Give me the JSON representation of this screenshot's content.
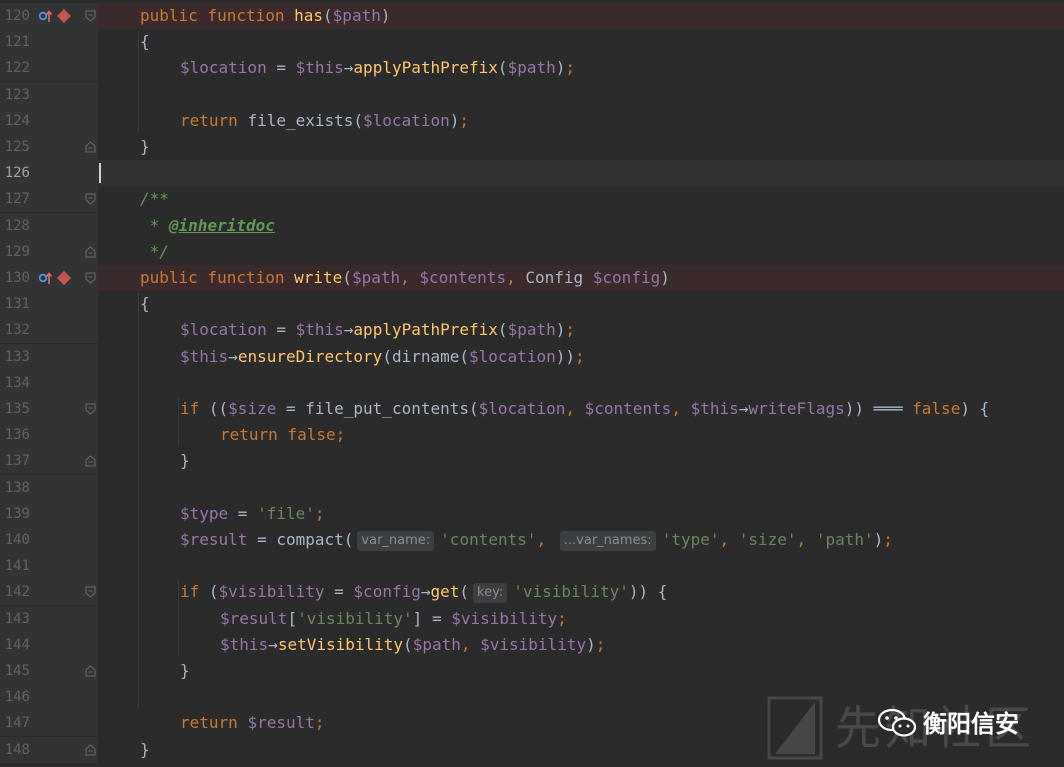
{
  "colors": {
    "background": "#2b2b2b",
    "gutter": "#313335",
    "breakpoint_line": "#3b2a2b",
    "keyword": "#cc7832",
    "function": "#ffc66d",
    "variable": "#9876aa",
    "string": "#6a8759",
    "plain": "#a9b7c6",
    "doc_comment": "#629755",
    "line_number": "#606366"
  },
  "lines": [
    {
      "num": "120",
      "indent": 0,
      "highlight": true,
      "override": true,
      "breakpoint": true,
      "fold": "start",
      "tokens": [
        {
          "c": "kw",
          "t": "public function "
        },
        {
          "c": "fn",
          "t": "has"
        },
        {
          "c": "pl",
          "t": "("
        },
        {
          "c": "vr",
          "t": "$path"
        },
        {
          "c": "pl",
          "t": ")"
        }
      ]
    },
    {
      "num": "121",
      "indent": 0,
      "tokens": [
        {
          "c": "pl",
          "t": "{"
        }
      ]
    },
    {
      "num": "122",
      "indent": 1,
      "tokens": [
        {
          "c": "vr",
          "t": "$location"
        },
        {
          "c": "pl",
          "t": " = "
        },
        {
          "c": "vr",
          "t": "$this"
        },
        {
          "c": "pl",
          "t": "→"
        },
        {
          "c": "fn",
          "t": "applyPathPrefix"
        },
        {
          "c": "pl",
          "t": "("
        },
        {
          "c": "vr",
          "t": "$path"
        },
        {
          "c": "pl",
          "t": ")"
        },
        {
          "c": "kw",
          "t": ";"
        }
      ]
    },
    {
      "num": "123",
      "indent": 1,
      "tokens": []
    },
    {
      "num": "124",
      "indent": 1,
      "tokens": [
        {
          "c": "kw",
          "t": "return "
        },
        {
          "c": "pl",
          "t": "file_exists("
        },
        {
          "c": "vr",
          "t": "$location"
        },
        {
          "c": "pl",
          "t": ")"
        },
        {
          "c": "kw",
          "t": ";"
        }
      ]
    },
    {
      "num": "125",
      "indent": 0,
      "fold": "end",
      "tokens": [
        {
          "c": "pl",
          "t": "}"
        }
      ]
    },
    {
      "num": "126",
      "indent": 0,
      "current": true,
      "tokens": []
    },
    {
      "num": "127",
      "indent": 0,
      "fold": "start",
      "tokens": [
        {
          "c": "cm",
          "t": "/**"
        }
      ]
    },
    {
      "num": "128",
      "indent": 0,
      "tokens": [
        {
          "c": "cm",
          "t": " * "
        },
        {
          "c": "tag",
          "t": "@inheritdoc"
        }
      ]
    },
    {
      "num": "129",
      "indent": 0,
      "fold": "end",
      "tokens": [
        {
          "c": "cm",
          "t": " */"
        }
      ]
    },
    {
      "num": "130",
      "indent": 0,
      "highlight": true,
      "override": true,
      "breakpoint": true,
      "fold": "start",
      "tokens": [
        {
          "c": "kw",
          "t": "public function "
        },
        {
          "c": "fn",
          "t": "write"
        },
        {
          "c": "pl",
          "t": "("
        },
        {
          "c": "vr",
          "t": "$path"
        },
        {
          "c": "kw",
          "t": ", "
        },
        {
          "c": "vr",
          "t": "$contents"
        },
        {
          "c": "kw",
          "t": ", "
        },
        {
          "c": "pl",
          "t": "Config "
        },
        {
          "c": "vr",
          "t": "$config"
        },
        {
          "c": "pl",
          "t": ")"
        }
      ]
    },
    {
      "num": "131",
      "indent": 0,
      "tokens": [
        {
          "c": "pl",
          "t": "{"
        }
      ]
    },
    {
      "num": "132",
      "indent": 1,
      "tokens": [
        {
          "c": "vr",
          "t": "$location"
        },
        {
          "c": "pl",
          "t": " = "
        },
        {
          "c": "vr",
          "t": "$this"
        },
        {
          "c": "pl",
          "t": "→"
        },
        {
          "c": "fn",
          "t": "applyPathPrefix"
        },
        {
          "c": "pl",
          "t": "("
        },
        {
          "c": "vr",
          "t": "$path"
        },
        {
          "c": "pl",
          "t": ")"
        },
        {
          "c": "kw",
          "t": ";"
        }
      ]
    },
    {
      "num": "133",
      "indent": 1,
      "tokens": [
        {
          "c": "vr",
          "t": "$this"
        },
        {
          "c": "pl",
          "t": "→"
        },
        {
          "c": "fn",
          "t": "ensureDirectory"
        },
        {
          "c": "pl",
          "t": "(dirname("
        },
        {
          "c": "vr",
          "t": "$location"
        },
        {
          "c": "pl",
          "t": "))"
        },
        {
          "c": "kw",
          "t": ";"
        }
      ]
    },
    {
      "num": "134",
      "indent": 1,
      "tokens": []
    },
    {
      "num": "135",
      "indent": 1,
      "fold": "start",
      "tokens": [
        {
          "c": "kw",
          "t": "if "
        },
        {
          "c": "pl",
          "t": "(("
        },
        {
          "c": "vr",
          "t": "$size"
        },
        {
          "c": "pl",
          "t": " = file_put_contents("
        },
        {
          "c": "vr",
          "t": "$location"
        },
        {
          "c": "kw",
          "t": ", "
        },
        {
          "c": "vr",
          "t": "$contents"
        },
        {
          "c": "kw",
          "t": ", "
        },
        {
          "c": "vr",
          "t": "$this"
        },
        {
          "c": "pl",
          "t": "→"
        },
        {
          "c": "vr",
          "t": "writeFlags"
        },
        {
          "c": "pl",
          "t": ")) ═══ "
        },
        {
          "c": "kw",
          "t": "false"
        },
        {
          "c": "pl",
          "t": ") {"
        }
      ]
    },
    {
      "num": "136",
      "indent": 2,
      "tokens": [
        {
          "c": "kw",
          "t": "return false;"
        }
      ]
    },
    {
      "num": "137",
      "indent": 1,
      "fold": "end",
      "tokens": [
        {
          "c": "pl",
          "t": "}"
        }
      ]
    },
    {
      "num": "138",
      "indent": 1,
      "tokens": []
    },
    {
      "num": "139",
      "indent": 1,
      "tokens": [
        {
          "c": "vr",
          "t": "$type"
        },
        {
          "c": "pl",
          "t": " = "
        },
        {
          "c": "st",
          "t": "'file'"
        },
        {
          "c": "kw",
          "t": ";"
        }
      ]
    },
    {
      "num": "140",
      "indent": 1,
      "tokens": [
        {
          "c": "vr",
          "t": "$result"
        },
        {
          "c": "pl",
          "t": " = compact("
        },
        {
          "c": "hint",
          "t": "var_name:"
        },
        {
          "c": "st",
          "t": "'contents'"
        },
        {
          "c": "kw",
          "t": ", "
        },
        {
          "c": "hint",
          "t": "...var_names:"
        },
        {
          "c": "st",
          "t": "'type'"
        },
        {
          "c": "kw",
          "t": ", "
        },
        {
          "c": "st",
          "t": "'size'"
        },
        {
          "c": "kw",
          "t": ", "
        },
        {
          "c": "st",
          "t": "'path'"
        },
        {
          "c": "pl",
          "t": ")"
        },
        {
          "c": "kw",
          "t": ";"
        }
      ]
    },
    {
      "num": "141",
      "indent": 1,
      "tokens": []
    },
    {
      "num": "142",
      "indent": 1,
      "fold": "start",
      "tokens": [
        {
          "c": "kw",
          "t": "if "
        },
        {
          "c": "pl",
          "t": "("
        },
        {
          "c": "vr",
          "t": "$visibility"
        },
        {
          "c": "pl",
          "t": " = "
        },
        {
          "c": "vr",
          "t": "$config"
        },
        {
          "c": "pl",
          "t": "→"
        },
        {
          "c": "fn",
          "t": "get"
        },
        {
          "c": "pl",
          "t": "("
        },
        {
          "c": "hint",
          "t": "key:"
        },
        {
          "c": "st",
          "t": "'visibility'"
        },
        {
          "c": "pl",
          "t": ")) {"
        }
      ]
    },
    {
      "num": "143",
      "indent": 2,
      "tokens": [
        {
          "c": "vr",
          "t": "$result"
        },
        {
          "c": "pl",
          "t": "["
        },
        {
          "c": "st",
          "t": "'visibility'"
        },
        {
          "c": "pl",
          "t": "] = "
        },
        {
          "c": "vr",
          "t": "$visibility"
        },
        {
          "c": "kw",
          "t": ";"
        }
      ]
    },
    {
      "num": "144",
      "indent": 2,
      "tokens": [
        {
          "c": "vr",
          "t": "$this"
        },
        {
          "c": "pl",
          "t": "→"
        },
        {
          "c": "fn",
          "t": "setVisibility"
        },
        {
          "c": "pl",
          "t": "("
        },
        {
          "c": "vr",
          "t": "$path"
        },
        {
          "c": "kw",
          "t": ", "
        },
        {
          "c": "vr",
          "t": "$visibility"
        },
        {
          "c": "pl",
          "t": ")"
        },
        {
          "c": "kw",
          "t": ";"
        }
      ]
    },
    {
      "num": "145",
      "indent": 1,
      "fold": "end",
      "tokens": [
        {
          "c": "pl",
          "t": "}"
        }
      ]
    },
    {
      "num": "146",
      "indent": 1,
      "tokens": []
    },
    {
      "num": "147",
      "indent": 1,
      "tokens": [
        {
          "c": "kw",
          "t": "return "
        },
        {
          "c": "vr",
          "t": "$result"
        },
        {
          "c": "kw",
          "t": ";"
        }
      ]
    },
    {
      "num": "148",
      "indent": 0,
      "fold": "end",
      "tokens": [
        {
          "c": "pl",
          "t": "}"
        }
      ]
    }
  ],
  "watermark": {
    "logo_text": "先知社区",
    "account_name": "衡阳信安",
    "account_icon": "wechat-icon"
  }
}
